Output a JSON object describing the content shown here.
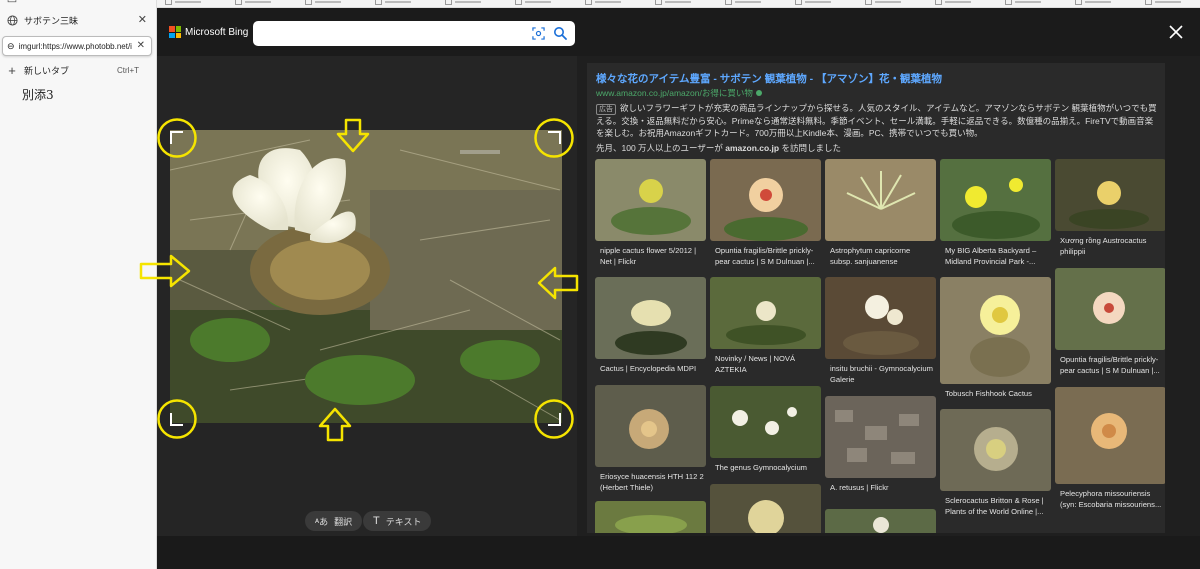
{
  "sidebar": {
    "tabs": [
      {
        "label": "サボテン三昧",
        "icon": "globe-icon"
      }
    ],
    "url_value": "imgurl:https://www.photobb.net/i",
    "new_tab_label": "新しいタブ",
    "new_tab_shortcut": "Ctrl+T",
    "group_label": "別添3"
  },
  "bing": {
    "brand": "Microsoft Bing",
    "search_value": "",
    "colors": {
      "accent": "#5ea8ff",
      "url_green": "#4ca96a",
      "highlight_yellow": "#f5e400"
    }
  },
  "viewer": {
    "translate_label": "翻訳",
    "text_label": "テキスト"
  },
  "ad": {
    "title": "様々な花のアイテム豊富 - サボテン 観葉植物 - 【アマゾン】花・観葉植物",
    "url": "www.amazon.co.jp/amazon/お得に買い物",
    "badge": "広告",
    "description": "欲しいフラワーギフトが充実の商品ラインナップから探せる。人気のスタイル、アイテムなど。アマゾンならサボテン 観葉植物がいつでも買える。交換・返品無料だから安心。Primeなら通常送料無料。季節イベント、セール満載。手軽に返品できる。数億種の品揃え。FireTVで動画音楽を楽しむ。お祝用Amazonギフトカード。700万冊以上Kindle本、漫画。PC、携帯でいつでも買い物。",
    "visitors_prefix": "先月、100 万人以上のユーザーが ",
    "visitors_domain": "amazon.co.jp",
    "visitors_suffix": " を訪問しました"
  },
  "results": [
    {
      "caption": "nipple cactus flower 5/2012 | Net | Flickr"
    },
    {
      "caption": "Opuntia fragilis/Brittle prickly-pear cactus | S M Dulnuan |..."
    },
    {
      "caption": "Astrophytum capricorne subsp. sanjuanense"
    },
    {
      "caption": "My BIG Alberta Backyard – Midland Provincial Park -..."
    },
    {
      "caption": "Xương rồng Austrocactus philippii"
    },
    {
      "caption": "Cactus | Encyclopedia MDPI"
    },
    {
      "caption": "Novinky / News | NOVÁ AZTEKIA"
    },
    {
      "caption": "insitu bruchii - Gymnocalycium Galerie"
    },
    {
      "caption": "Tobusch Fishhook Cactus"
    },
    {
      "caption": "Opuntia fragilis/Brittle prickly-pear cactus | S M Dulnuan |..."
    },
    {
      "caption": "Eriosyce huacensis HTH 112 2 (Herbert Thiele)"
    },
    {
      "caption": "The genus Gymnocalycium"
    },
    {
      "caption": "A. retusus | Flickr"
    },
    {
      "caption": "Sclerocactus Britton & Rose | Plants of the World Online |..."
    },
    {
      "caption": "Pelecyphora missouriensis (syn: Escobaria missouriens..."
    }
  ]
}
